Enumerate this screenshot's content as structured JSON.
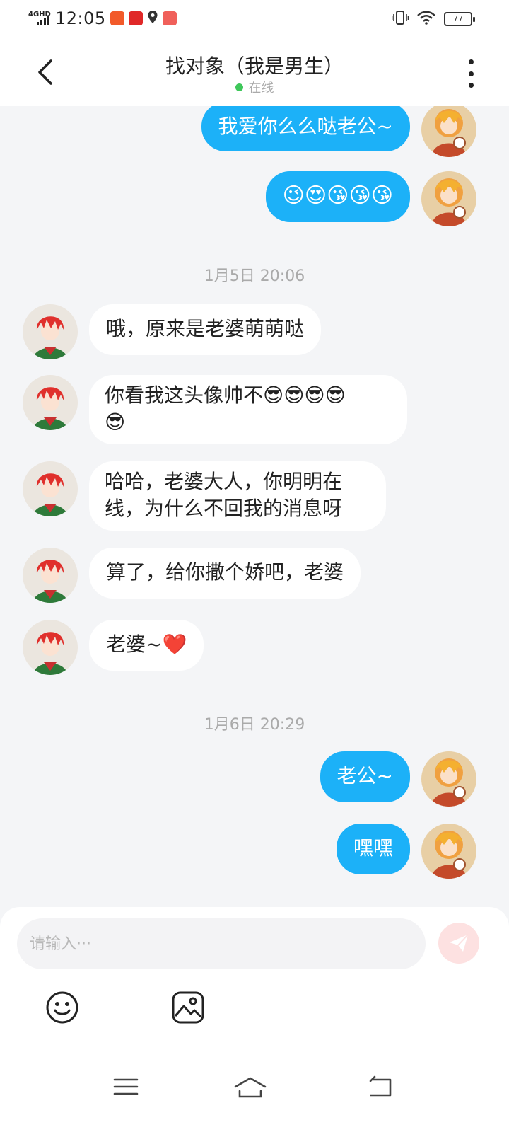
{
  "status_bar": {
    "network": "4GHD",
    "time": "12:05",
    "battery": "77"
  },
  "header": {
    "title": "找对象（我是男生）",
    "status": "在线"
  },
  "messages": [
    {
      "from": "me",
      "text": "我爱你么么哒老公~"
    },
    {
      "from": "me",
      "text": "😉😍😘😘😘"
    },
    {
      "type": "time",
      "text": "1月5日 20:06"
    },
    {
      "from": "them",
      "text": "哦，原来是老婆萌萌哒"
    },
    {
      "from": "them",
      "line1": "你看我这头像帅不😎😎😎😎",
      "line2": "😎"
    },
    {
      "from": "them",
      "line1": "哈哈，老婆大人，你明明在",
      "line2": "线，为什么不回我的消息呀"
    },
    {
      "from": "them",
      "text": "算了，给你撒个娇吧，老婆"
    },
    {
      "from": "them",
      "text": "老婆~❤️"
    },
    {
      "type": "time",
      "text": "1月6日 20:29"
    },
    {
      "from": "me",
      "text": "老公~"
    },
    {
      "from": "me",
      "text": "嘿嘿"
    }
  ],
  "composer": {
    "placeholder": "请输入···"
  },
  "icons": {
    "back": "chevron-left-icon",
    "more": "more-vertical-icon",
    "send": "send-icon",
    "emoji": "emoji-icon",
    "image": "image-icon",
    "nav_menu": "menu-icon",
    "nav_home": "home-icon",
    "nav_back": "back-icon"
  },
  "colors": {
    "my_bubble": "#1cb1f8",
    "their_bubble": "#ffffff",
    "background": "#f4f5f7",
    "online": "#3ec75a",
    "send_button": "#fde1e1"
  }
}
